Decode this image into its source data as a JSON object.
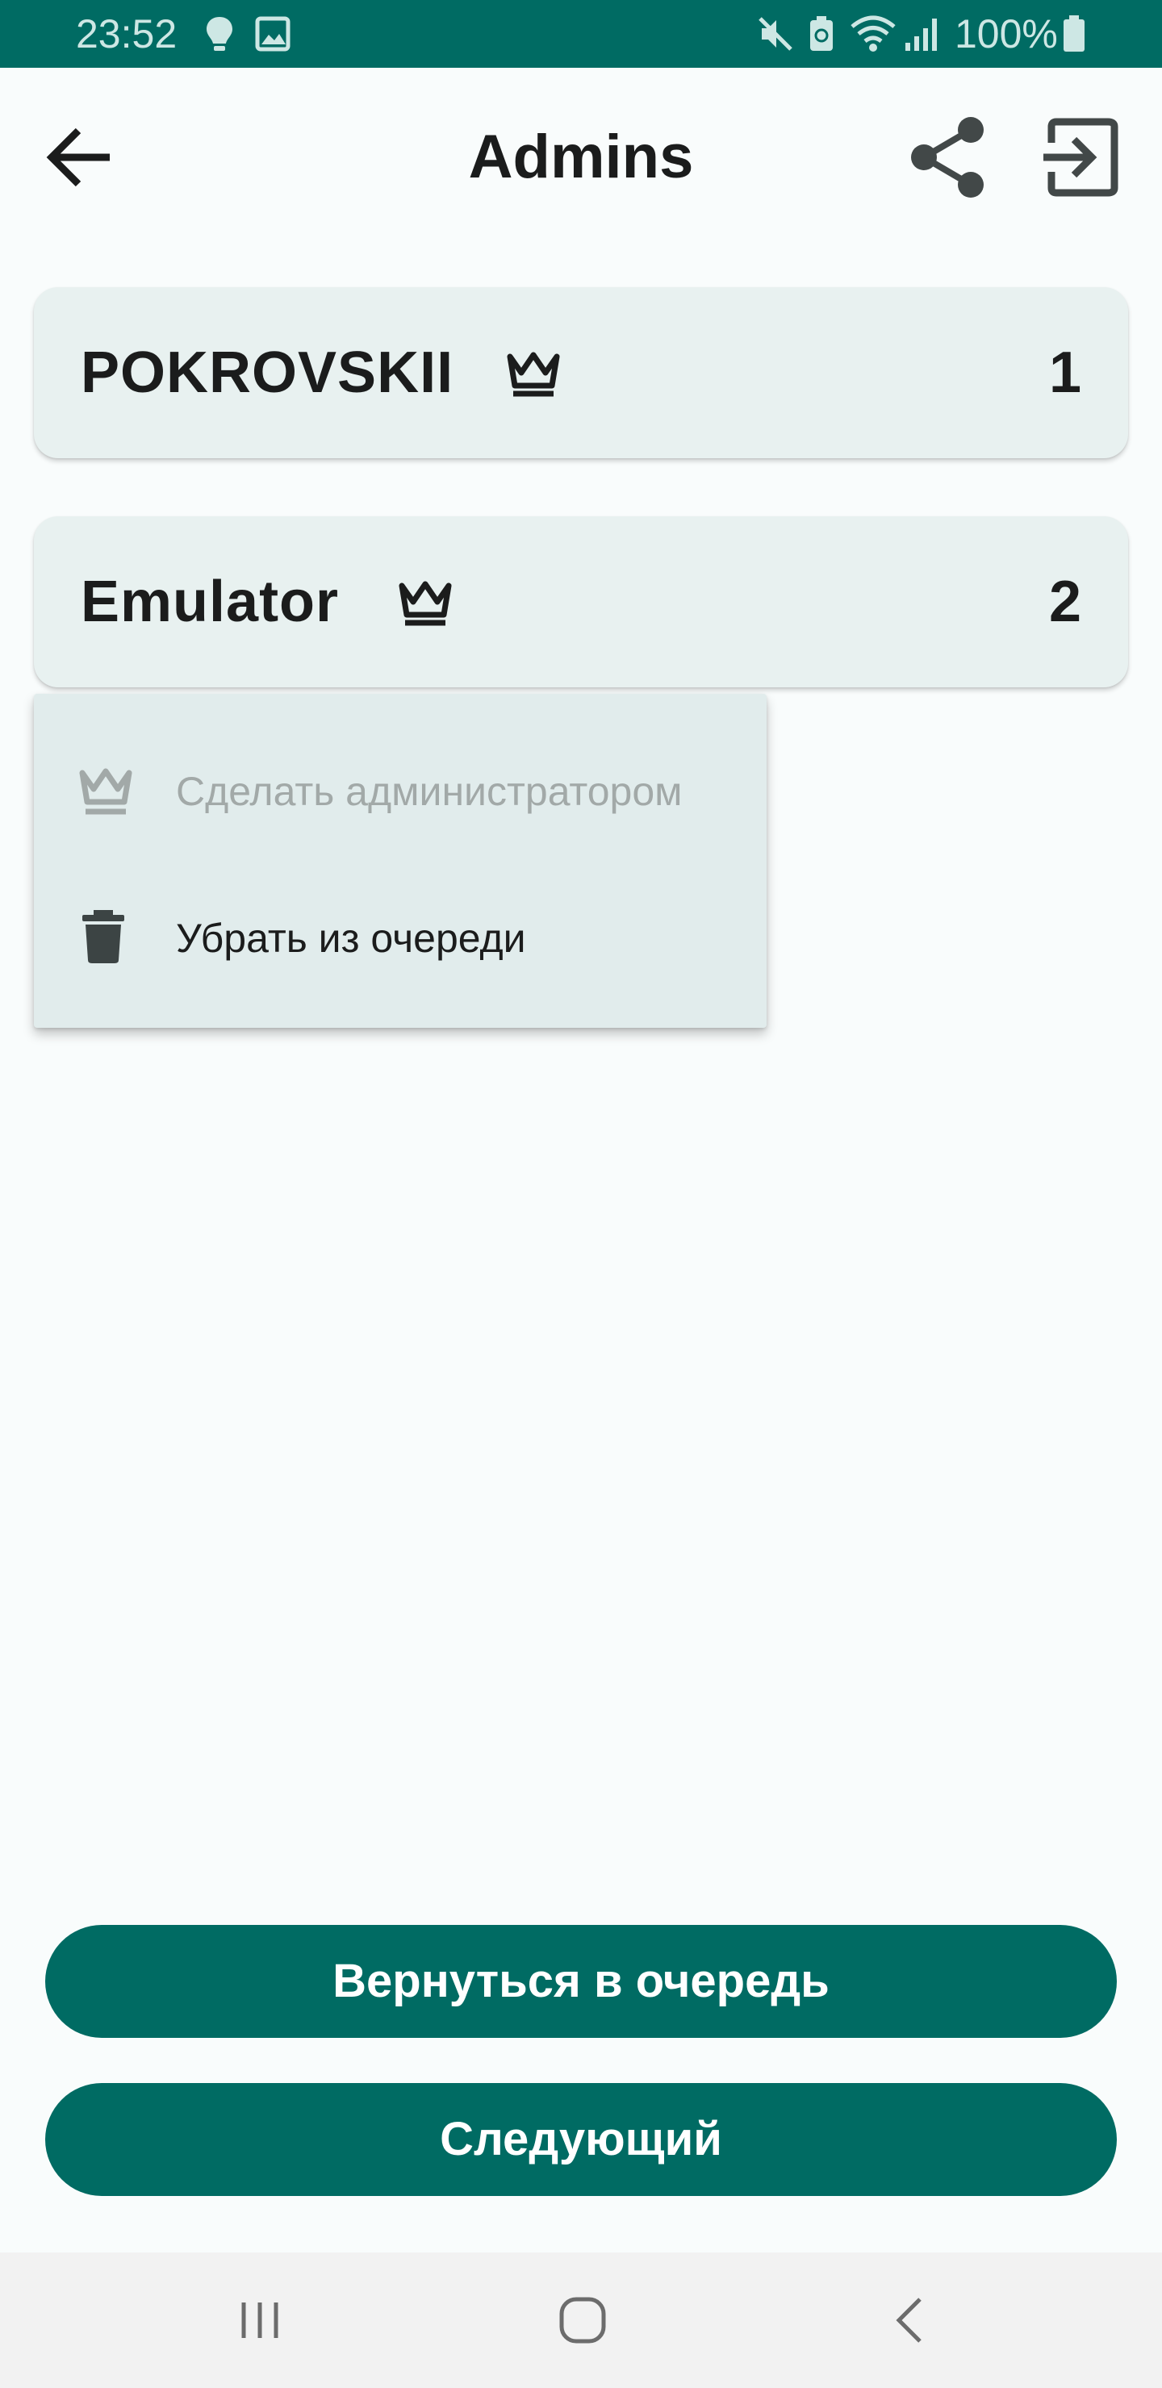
{
  "status_bar": {
    "time": "23:52",
    "battery_percent": "100%",
    "background_color": "#006b63",
    "icons": [
      "bulb-icon",
      "image-icon",
      "mute-icon",
      "battery-saver-icon",
      "wifi-icon",
      "signal-icon",
      "battery-icon"
    ]
  },
  "app_bar": {
    "title": "Admins",
    "back_icon": "arrow-back-icon",
    "share_icon": "share-icon",
    "exit_icon": "exit-icon"
  },
  "queue": {
    "items": [
      {
        "name": "POKROVSKII",
        "position": "1",
        "is_admin": true,
        "badge_icon": "crown-icon"
      },
      {
        "name": "Emulator",
        "position": "2",
        "is_admin": true,
        "badge_icon": "crown-icon"
      }
    ]
  },
  "context_menu": {
    "items": [
      {
        "label": "Сделать администратором",
        "icon": "crown-icon",
        "enabled": false
      },
      {
        "label": "Убрать из очереди",
        "icon": "trash-icon",
        "enabled": true
      }
    ]
  },
  "actions": {
    "return_label": "Вернуться в очередь",
    "next_label": "Следующий",
    "accent_color": "#006b63"
  },
  "nav_bar": {
    "icons": [
      "recents-icon",
      "home-icon",
      "back-icon"
    ]
  }
}
